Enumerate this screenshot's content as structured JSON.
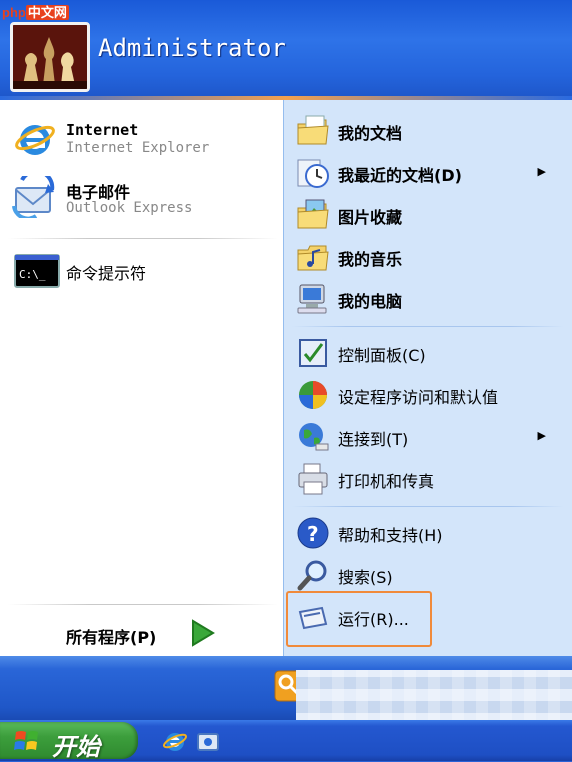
{
  "watermark": {
    "brand": "php",
    "site": "中文网"
  },
  "user": {
    "name": "Administrator"
  },
  "pinned": [
    {
      "title": "Internet",
      "subtitle": "Internet Explorer",
      "icon": "internet-explorer-icon"
    },
    {
      "title": "电子邮件",
      "subtitle": "Outlook Express",
      "icon": "outlook-express-icon"
    }
  ],
  "recent": [
    {
      "label": "命令提示符",
      "icon": "command-prompt-icon"
    }
  ],
  "all_programs": {
    "label": "所有程序(P)"
  },
  "places": [
    {
      "label": "我的文档",
      "icon": "my-documents-icon"
    },
    {
      "label": "我最近的文档(D)",
      "icon": "recent-documents-icon"
    },
    {
      "label": "图片收藏",
      "icon": "my-pictures-icon"
    },
    {
      "label": "我的音乐",
      "icon": "my-music-icon"
    },
    {
      "label": "我的电脑",
      "icon": "my-computer-icon"
    }
  ],
  "system": [
    {
      "label": "控制面板(C)",
      "icon": "control-panel-icon"
    },
    {
      "label": "设定程序访问和默认值",
      "icon": "program-defaults-icon"
    },
    {
      "label": "连接到(T)",
      "icon": "connect-to-icon"
    },
    {
      "label": "打印机和传真",
      "icon": "printers-fax-icon"
    }
  ],
  "help": [
    {
      "label": "帮助和支持(H)",
      "icon": "help-icon"
    },
    {
      "label": "搜索(S)",
      "icon": "search-icon"
    },
    {
      "label": "运行(R)...",
      "icon": "run-icon"
    }
  ],
  "footer": {
    "logoff_icon": "key-icon",
    "shutdown_icon": "power-icon"
  },
  "taskbar": {
    "start_label": "开始"
  },
  "colors": {
    "header": "#2464dc",
    "right_panel": "#d3e5fa",
    "start_green": "#3c9e3c",
    "highlight": "#f08a3a"
  }
}
